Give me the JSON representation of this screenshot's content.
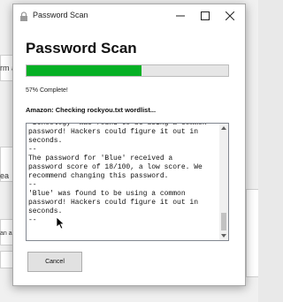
{
  "background": {
    "snippet_1": "rm a",
    "snippet_2": "ea",
    "snippet_3": "an a"
  },
  "window": {
    "title": "Password Scan",
    "icon": "lock-icon",
    "controls": [
      "minimize-icon",
      "maximize-icon",
      "close-icon"
    ]
  },
  "main": {
    "heading": "Password Scan",
    "progress_value": 0.57,
    "progress_text": "57% Complete!",
    "status_text": "Amazon: Checking rockyou.txt wordlist...",
    "log_lines": [
      "'Schoology' was found to be using a common",
      "password! Hackers could figure it out in",
      "seconds.",
      "--",
      "The password for 'Blue' received a",
      "password score of 18/100, a low score. We",
      "recommend changing this password.",
      "--",
      "'Blue' was found to be using a common",
      "password! Hackers could figure it out in",
      "seconds.",
      "--"
    ],
    "cancel_label": "Cancel"
  },
  "colors": {
    "progress": "#06b025"
  }
}
